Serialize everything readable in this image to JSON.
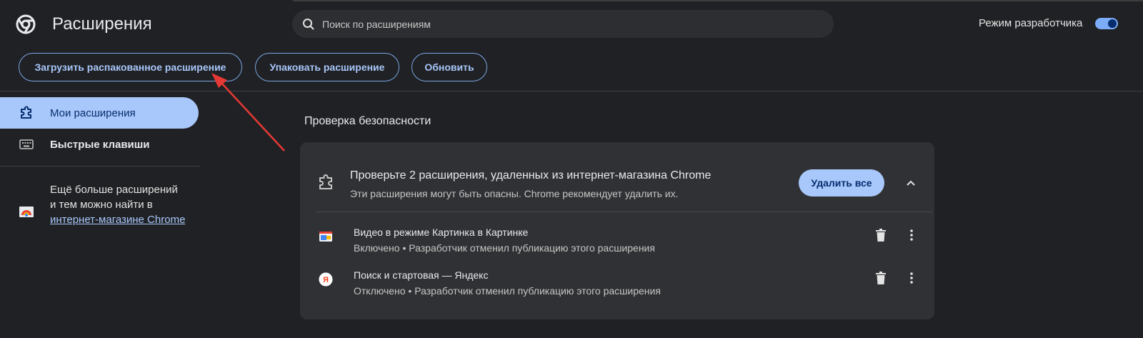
{
  "header": {
    "title": "Расширения",
    "search_placeholder": "Поиск по расширениям",
    "dev_mode_label": "Режим разработчика",
    "dev_mode_on": true
  },
  "toolbar": {
    "load_unpacked": "Загрузить распакованное расширение",
    "pack": "Упаковать расширение",
    "update": "Обновить"
  },
  "sidebar": {
    "items": [
      {
        "label": "Мои расширения",
        "icon": "puzzle-icon",
        "active": true
      },
      {
        "label": "Быстрые клавиши",
        "icon": "keyboard-icon",
        "active": false
      }
    ],
    "store_text_1": "Ещё больше расширений",
    "store_text_2": "и тем можно найти в",
    "store_link": "интернет-магазине Chrome"
  },
  "main": {
    "section_title": "Проверка безопасности",
    "card": {
      "heading": "Проверьте 2 расширения, удаленных из интернет-магазина Chrome",
      "subtitle": "Эти расширения могут быть опасны. Chrome рекомендует удалить их.",
      "remove_all": "Удалить все",
      "extensions": [
        {
          "name": "Видео в режиме Картинка в Картинке",
          "status": "Включено • Разработчик отменил публикацию этого расширения",
          "icon": "pip-icon"
        },
        {
          "name": "Поиск и стартовая — Яндекс",
          "status": "Отключено • Разработчик отменил публикацию этого расширения",
          "icon": "yandex-icon"
        }
      ]
    }
  },
  "colors": {
    "background": "#202124",
    "accent": "#a8c7fa",
    "annotation_arrow": "#e53935"
  }
}
